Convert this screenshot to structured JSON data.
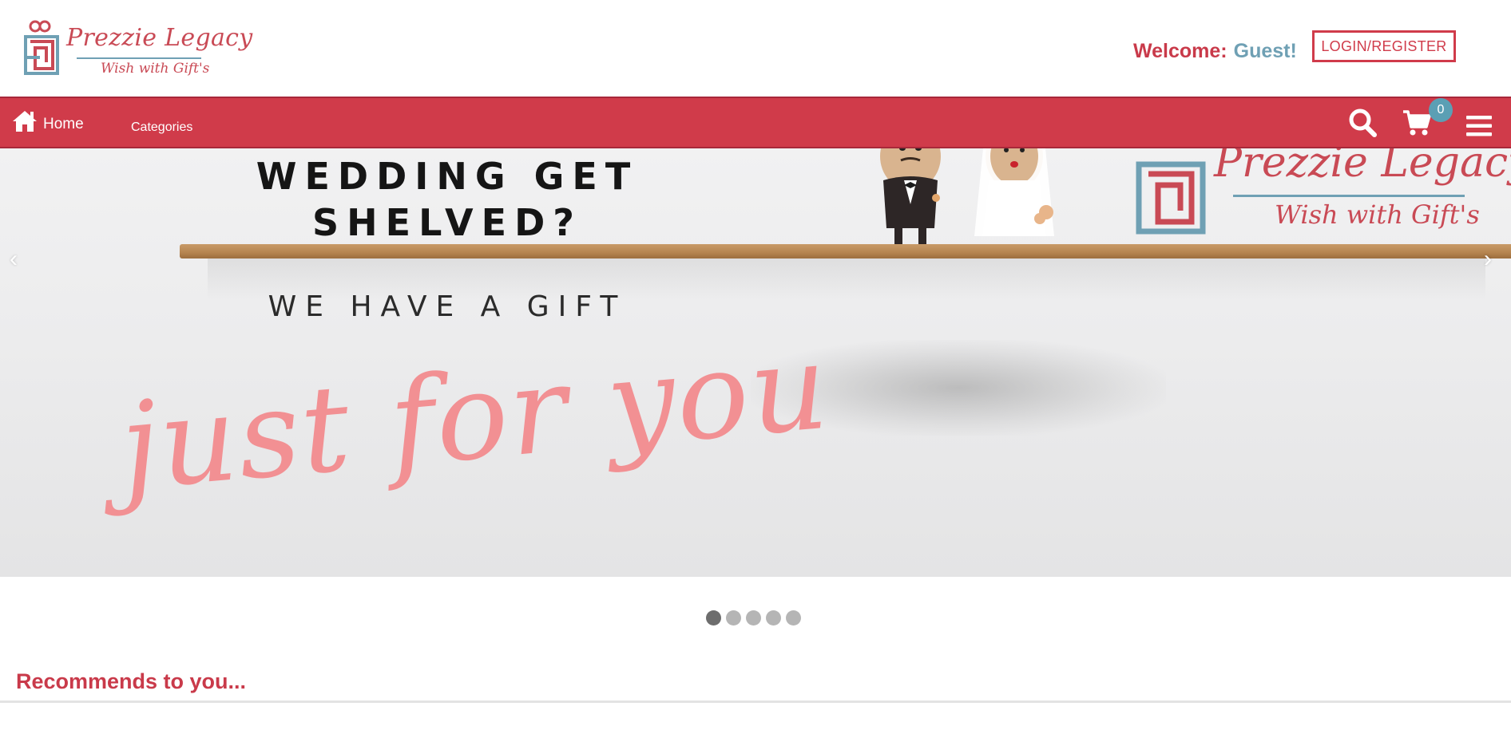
{
  "brand": {
    "name": "Prezzie Legacy",
    "tagline": "Wish with Gift's",
    "colors": {
      "primary_red": "#d03b4a",
      "accent_blue": "#6fa0b4"
    }
  },
  "header": {
    "welcome_label": "Welcome:",
    "welcome_user": "Guest!",
    "login_button": "LOGIN/REGISTER"
  },
  "nav": {
    "home_label": "Home",
    "categories_label": "Categories",
    "cart_count": "0",
    "icons": [
      "home-icon",
      "search-icon",
      "cart-icon",
      "menu-icon"
    ]
  },
  "banner": {
    "headline_line1": "WEDDING GET",
    "headline_line2": "SHELVED?",
    "subline": "WE HAVE A GIFT",
    "script_text": "just for you",
    "logo_title": "Prezzie Legacy",
    "logo_tagline": "Wish with Gift's",
    "prev_label": "‹",
    "next_label": "›",
    "slide_count": 5,
    "active_slide": 1
  },
  "recommendations": {
    "title": "Recommends to you..."
  }
}
